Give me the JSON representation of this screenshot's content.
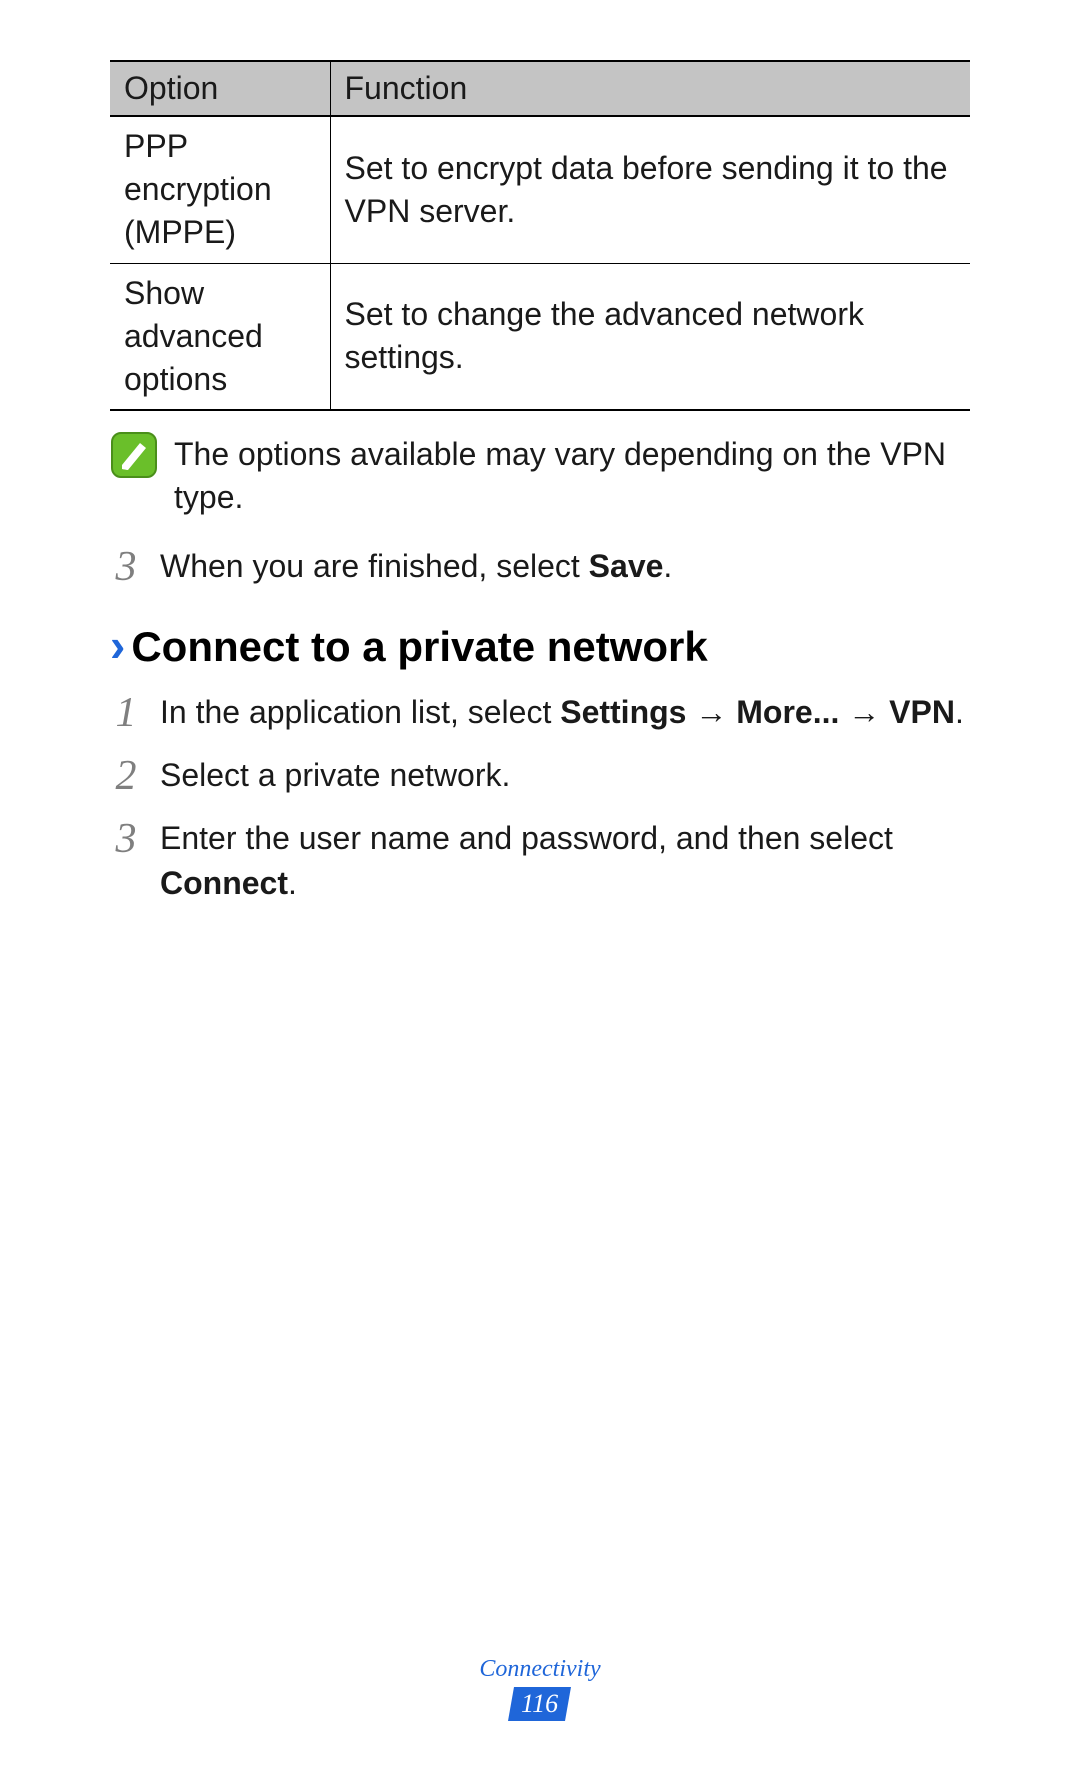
{
  "table": {
    "headers": {
      "option": "Option",
      "function": "Function"
    },
    "rows": [
      {
        "option": "PPP encryption (MPPE)",
        "function": "Set to encrypt data before sending it to the VPN server."
      },
      {
        "option": "Show advanced options",
        "function": "Set to change the advanced network settings."
      }
    ]
  },
  "note": "The options available may vary depending on the VPN type.",
  "step_pre": {
    "num": "3",
    "prefix": "When you are finished, select ",
    "bold": "Save",
    "suffix": "."
  },
  "section_title": "Connect to a private network",
  "steps": [
    {
      "num": "1",
      "parts": [
        "In the application list, select ",
        "Settings",
        " → ",
        "More...",
        " → ",
        "VPN",
        "."
      ],
      "boldidx": [
        1,
        3,
        5
      ]
    },
    {
      "num": "2",
      "text": "Select a private network."
    },
    {
      "num": "3",
      "prefix": "Enter the user name and password, and then select ",
      "bold": "Connect",
      "suffix": "."
    }
  ],
  "footer": {
    "section": "Connectivity",
    "page": "116"
  }
}
